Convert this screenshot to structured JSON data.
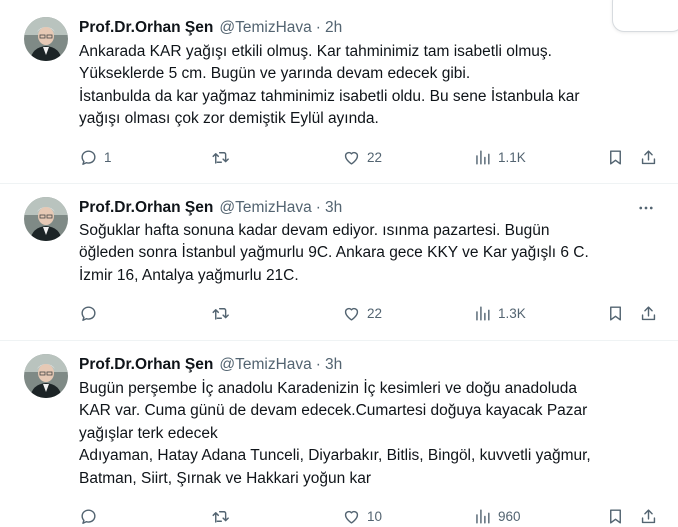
{
  "tweets": [
    {
      "name": "Prof.Dr.Orhan Şen",
      "handle": "@TemizHava",
      "time": "2h",
      "lines": [
        "Ankarada KAR yağışı etkili olmuş. Kar tahminimiz tam isabetli olmuş.",
        "Yükseklerde 5 cm. Bugün ve yarında devam edecek gibi.",
        "İstanbulda da kar yağmaz tahminimiz isabetli oldu. Bu sene İstanbula kar",
        "yağışı olması çok zor demiştik Eylül ayında."
      ],
      "replies": "1",
      "retweets": "",
      "likes": "22",
      "views": "1.1K"
    },
    {
      "name": "Prof.Dr.Orhan Şen",
      "handle": "@TemizHava",
      "time": "3h",
      "lines": [
        "Soğuklar hafta sonuna kadar devam ediyor. ısınma pazartesi. Bugün",
        "öğleden sonra İstanbul yağmurlu 9C. Ankara gece KKY ve Kar yağışlı 6 C.",
        "İzmir 16, Antalya yağmurlu 21C."
      ],
      "replies": "",
      "retweets": "",
      "likes": "22",
      "views": "1.3K"
    },
    {
      "name": "Prof.Dr.Orhan Şen",
      "handle": "@TemizHava",
      "time": "3h",
      "lines": [
        "Bugün perşembe İç anadolu Karadenizin İç kesimleri ve doğu anadoluda",
        "KAR var. Cuma günü de devam edecek.Cumartesi doğuya kayacak Pazar",
        "yağışlar terk edecek",
        "Adıyaman, Hatay Adana Tunceli, Diyarbakır, Bitlis, Bingöl, kuvvetli yağmur,",
        "Batman, Siirt, Şırnak ve  Hakkari yoğun kar"
      ],
      "replies": "",
      "retweets": "",
      "likes": "10",
      "views": "960"
    }
  ],
  "icons": {
    "more": "more-horizontal-icon",
    "reply": "reply-icon",
    "retweet": "retweet-icon",
    "like": "heart-icon",
    "views": "views-bar-chart-icon",
    "bookmark": "bookmark-icon",
    "share": "share-icon"
  },
  "colors": {
    "text": "#0f1419",
    "secondary": "#536471",
    "divider": "#eff3f4"
  }
}
